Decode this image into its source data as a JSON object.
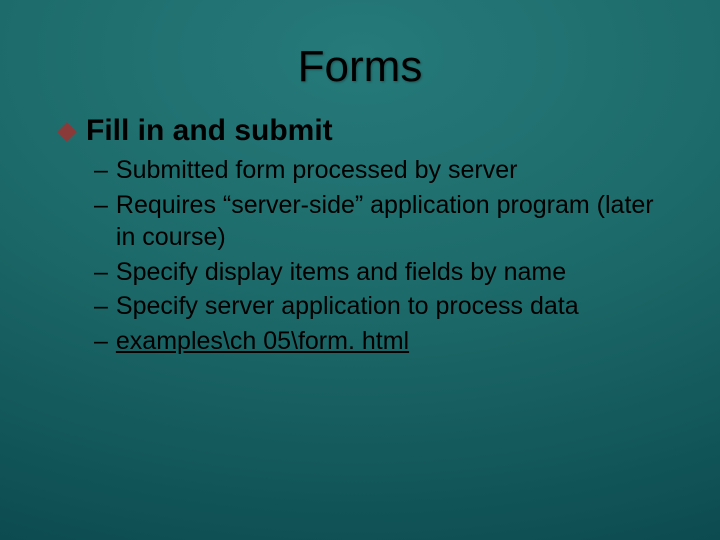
{
  "title": "Forms",
  "bullet_glyph": "diamond",
  "level1_text": "Fill in and submit",
  "sub_items": [
    {
      "dash": "–",
      "text": "Submitted form processed by server",
      "link": false
    },
    {
      "dash": "–",
      "text": "Requires “server-side” application program (later in course)",
      "link": false
    },
    {
      "dash": "–",
      "text": "Specify display items and fields by name",
      "link": false
    },
    {
      "dash": "–",
      "text": "Specify server application to process data",
      "link": false
    },
    {
      "dash": "–",
      "text": "examples\\ch 05\\form. html",
      "link": true
    }
  ]
}
